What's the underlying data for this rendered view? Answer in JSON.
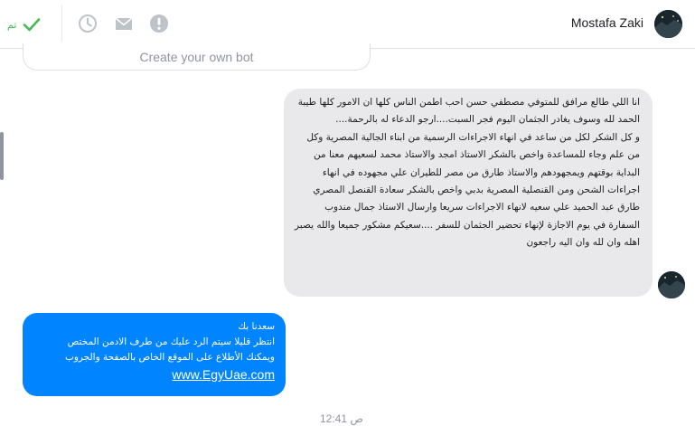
{
  "header": {
    "done_label": "تم",
    "contact_name": "Mostafa Zaki",
    "icons": [
      "check-icon",
      "clock-icon",
      "mail-icon",
      "alert-icon"
    ],
    "colors": {
      "done": "#44b955",
      "icon_gray": "#bec3c9"
    }
  },
  "conversation": {
    "bot_button_label": "Create your own bot",
    "incoming_message": "انا اللي طالع مرافق للمتوفي مصطفي حسن احب اطمن الناس كلها ان الامور كلها طيبة الحمد لله وسوف يغادر الجثمان اليوم فجر السبت....ارجو الدعاء له بالرحمة....\nو كل الشكر لكل من ساعد في انهاء الاجراءات الرسمية من ابناء الجالية المصرية وكل من علم وجاء للمساعدة واخص بالشكر الاستاذ امجد والاستاذ محمد لسعيهم معنا من البداية بوقتهم ويمجهودهم والاستاذ طارق من مصر للطيران علي مجهوده في انهاء اجراءات الشحن ومن القنصلية المصرية بدبي واخص بالشكر سعادة القنصل المصري طارق عبد الحميد علي سعيه لانهاء الاجراءات سريعا وارسال الاستاذ جمال مندوب السفارة في يوم الاجازة لإنهاء تحضير الجثمان للسفر ....سعيكم مشكور جميعا والله يصبر اهله وان لله وان اليه راجعون",
    "outgoing_message": {
      "line1": "سعدنا بك",
      "line2": "انتظر قليلا سيتم الرد عليك من طرف الادمن المختص",
      "line3": "ويمكنك الأطلاع على الموقع الخاص بالصفحة والجروب",
      "link": "www.EgyUae.com"
    },
    "timestamp": "12:41 ص",
    "colors": {
      "incoming_bubble": "#e9e9eb",
      "outgoing_bubble": "#0084ff"
    }
  }
}
